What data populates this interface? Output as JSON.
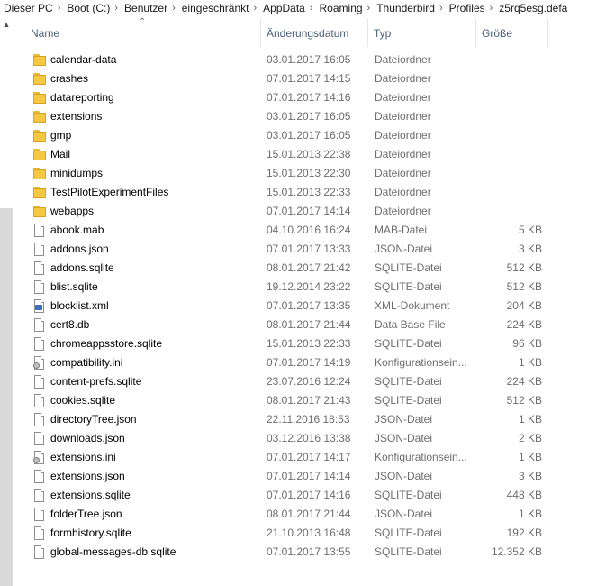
{
  "breadcrumb": [
    "Dieser PC",
    "Boot (C:)",
    "Benutzer",
    "eingeschränkt",
    "AppData",
    "Roaming",
    "Thunderbird",
    "Profiles",
    "z5rq5esg.defa"
  ],
  "columns": {
    "name": "Name",
    "date": "Änderungsdatum",
    "type": "Typ",
    "size": "Größe"
  },
  "files": [
    {
      "name": "calendar-data",
      "date": "03.01.2017 16:05",
      "type": "Dateiordner",
      "size": "",
      "icon": "folder"
    },
    {
      "name": "crashes",
      "date": "07.01.2017 14:15",
      "type": "Dateiordner",
      "size": "",
      "icon": "folder"
    },
    {
      "name": "datareporting",
      "date": "07.01.2017 14:16",
      "type": "Dateiordner",
      "size": "",
      "icon": "folder"
    },
    {
      "name": "extensions",
      "date": "03.01.2017 16:05",
      "type": "Dateiordner",
      "size": "",
      "icon": "folder"
    },
    {
      "name": "gmp",
      "date": "03.01.2017 16:05",
      "type": "Dateiordner",
      "size": "",
      "icon": "folder"
    },
    {
      "name": "Mail",
      "date": "15.01.2013 22:38",
      "type": "Dateiordner",
      "size": "",
      "icon": "folder"
    },
    {
      "name": "minidumps",
      "date": "15.01.2013 22:30",
      "type": "Dateiordner",
      "size": "",
      "icon": "folder"
    },
    {
      "name": "TestPilotExperimentFiles",
      "date": "15.01.2013 22:33",
      "type": "Dateiordner",
      "size": "",
      "icon": "folder"
    },
    {
      "name": "webapps",
      "date": "07.01.2017 14:14",
      "type": "Dateiordner",
      "size": "",
      "icon": "folder"
    },
    {
      "name": "abook.mab",
      "date": "04.10.2016 16:24",
      "type": "MAB-Datei",
      "size": "5 KB",
      "icon": "file"
    },
    {
      "name": "addons.json",
      "date": "07.01.2017 13:33",
      "type": "JSON-Datei",
      "size": "3 KB",
      "icon": "file"
    },
    {
      "name": "addons.sqlite",
      "date": "08.01.2017 21:42",
      "type": "SQLITE-Datei",
      "size": "512 KB",
      "icon": "file"
    },
    {
      "name": "blist.sqlite",
      "date": "19.12.2014 23:22",
      "type": "SQLITE-Datei",
      "size": "512 KB",
      "icon": "file"
    },
    {
      "name": "blocklist.xml",
      "date": "07.01.2017 13:35",
      "type": "XML-Dokument",
      "size": "204 KB",
      "icon": "xml"
    },
    {
      "name": "cert8.db",
      "date": "08.01.2017 21:44",
      "type": "Data Base File",
      "size": "224 KB",
      "icon": "file"
    },
    {
      "name": "chromeappsstore.sqlite",
      "date": "15.01.2013 22:33",
      "type": "SQLITE-Datei",
      "size": "96 KB",
      "icon": "file"
    },
    {
      "name": "compatibility.ini",
      "date": "07.01.2017 14:19",
      "type": "Konfigurationsein...",
      "size": "1 KB",
      "icon": "ini"
    },
    {
      "name": "content-prefs.sqlite",
      "date": "23.07.2016 12:24",
      "type": "SQLITE-Datei",
      "size": "224 KB",
      "icon": "file"
    },
    {
      "name": "cookies.sqlite",
      "date": "08.01.2017 21:43",
      "type": "SQLITE-Datei",
      "size": "512 KB",
      "icon": "file"
    },
    {
      "name": "directoryTree.json",
      "date": "22.11.2016 18:53",
      "type": "JSON-Datei",
      "size": "1 KB",
      "icon": "file"
    },
    {
      "name": "downloads.json",
      "date": "03.12.2016 13:38",
      "type": "JSON-Datei",
      "size": "2 KB",
      "icon": "file"
    },
    {
      "name": "extensions.ini",
      "date": "07.01.2017 14:17",
      "type": "Konfigurationsein...",
      "size": "1 KB",
      "icon": "ini"
    },
    {
      "name": "extensions.json",
      "date": "07.01.2017 14:14",
      "type": "JSON-Datei",
      "size": "3 KB",
      "icon": "file"
    },
    {
      "name": "extensions.sqlite",
      "date": "07.01.2017 14:16",
      "type": "SQLITE-Datei",
      "size": "448 KB",
      "icon": "file"
    },
    {
      "name": "folderTree.json",
      "date": "08.01.2017 21:44",
      "type": "JSON-Datei",
      "size": "1 KB",
      "icon": "file"
    },
    {
      "name": "formhistory.sqlite",
      "date": "21.10.2013 16:48",
      "type": "SQLITE-Datei",
      "size": "192 KB",
      "icon": "file"
    },
    {
      "name": "global-messages-db.sqlite",
      "date": "07.01.2017 13:55",
      "type": "SQLITE-Datei",
      "size": "12.352 KB",
      "icon": "file"
    }
  ]
}
